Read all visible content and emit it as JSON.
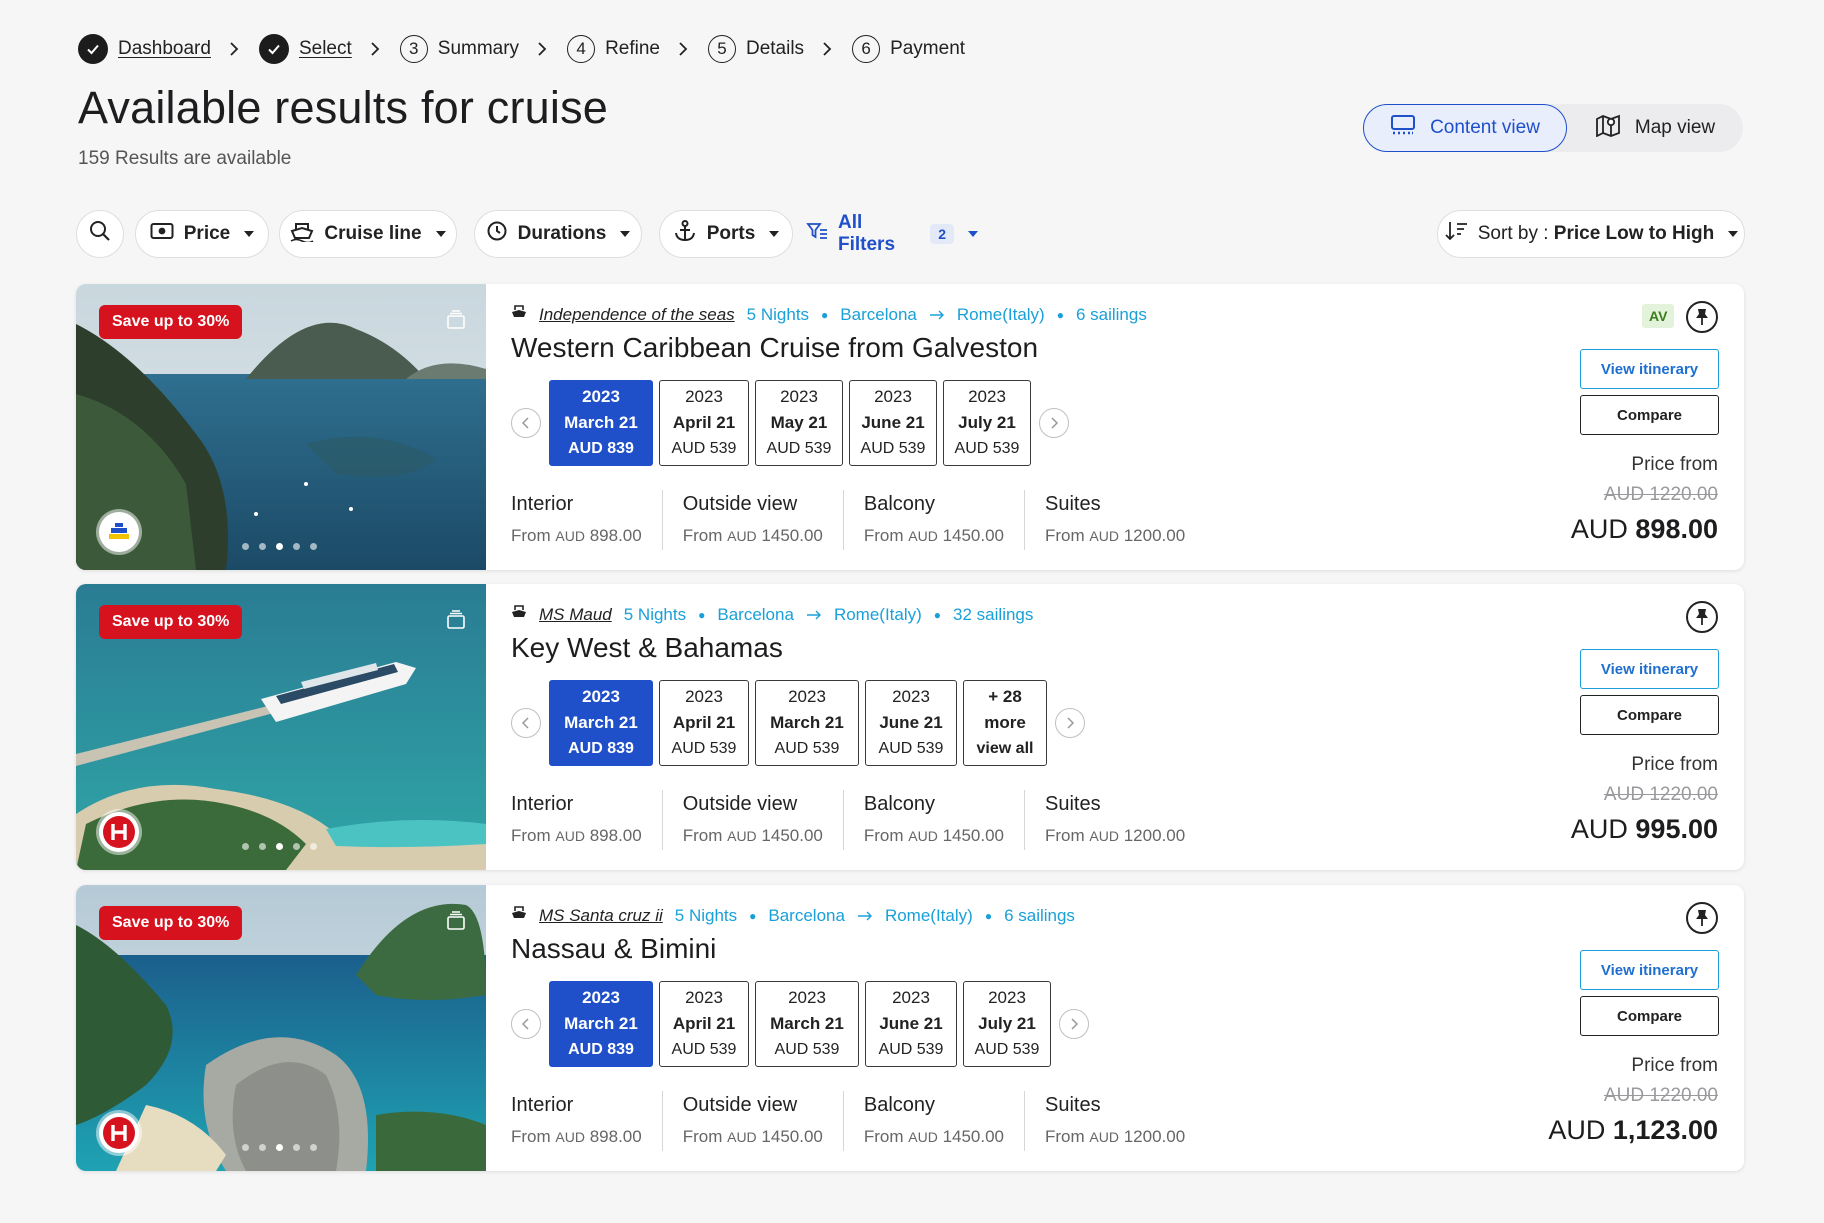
{
  "breadcrumb": [
    {
      "label": "Dashboard",
      "done": true
    },
    {
      "label": "Select",
      "done": true
    },
    {
      "num": "3",
      "label": "Summary"
    },
    {
      "num": "4",
      "label": "Refine"
    },
    {
      "num": "5",
      "label": "Details"
    },
    {
      "num": "6",
      "label": "Payment"
    }
  ],
  "page": {
    "title": "Available results for cruise",
    "count": "159 Results are available"
  },
  "views": {
    "content": "Content view",
    "map": "Map view"
  },
  "filters": {
    "price": "Price",
    "cruise_line": "Cruise line",
    "durations": "Durations",
    "ports": "Ports",
    "all": "All Filters",
    "all_count": "2",
    "sort_label": "Sort by : ",
    "sort_value": "Price Low to High"
  },
  "cards": [
    {
      "save": "Save up to 30%",
      "ship": "Independence of the seas",
      "nights": "5 Nights",
      "from": "Barcelona",
      "to": "Rome(Italy)",
      "sailings": "6 sailings",
      "title": "Western Caribbean Cruise from Galveston",
      "av": "AV",
      "dates": [
        {
          "y": "2023",
          "md": "March 21",
          "p": "AUD 839"
        },
        {
          "y": "2023",
          "md": "April 21",
          "p": "AUD 539"
        },
        {
          "y": "2023",
          "md": "May 21",
          "p": "AUD 539"
        },
        {
          "y": "2023",
          "md": "June 21",
          "p": "AUD 539"
        },
        {
          "y": "2023",
          "md": "July 21",
          "p": "AUD 539"
        }
      ],
      "cabins": [
        {
          "t": "Interior",
          "f": "From",
          "c": "AUD",
          "v": "898.00"
        },
        {
          "t": "Outside view",
          "f": "From",
          "c": "AUD",
          "v": "1450.00"
        },
        {
          "t": "Balcony",
          "f": "From",
          "c": "AUD",
          "v": "1450.00"
        },
        {
          "t": "Suites",
          "f": "From",
          "c": "AUD",
          "v": "1200.00"
        }
      ],
      "view_itinerary": "View itinerary",
      "compare": "Compare",
      "price_from": "Price from",
      "old_price": "AUD 1220.00",
      "cur": "AUD",
      "price": "898.00"
    },
    {
      "save": "Save up to 30%",
      "ship": "MS Maud",
      "nights": "5 Nights",
      "from": "Barcelona",
      "to": "Rome(Italy)",
      "sailings": "32 sailings",
      "title": "Key West & Bahamas",
      "dates": [
        {
          "y": "2023",
          "md": "March 21",
          "p": "AUD 839"
        },
        {
          "y": "2023",
          "md": "April 21",
          "p": "AUD 539"
        },
        {
          "y": "2023",
          "md": "March 21",
          "p": "AUD 539"
        },
        {
          "y": "2023",
          "md": "June 21",
          "p": "AUD 539"
        },
        {
          "y": "+ 28",
          "md": "more",
          "p": "view all"
        }
      ],
      "cabins": [
        {
          "t": "Interior",
          "f": "From",
          "c": "AUD",
          "v": "898.00"
        },
        {
          "t": "Outside view",
          "f": "From",
          "c": "AUD",
          "v": "1450.00"
        },
        {
          "t": "Balcony",
          "f": "From",
          "c": "AUD",
          "v": "1450.00"
        },
        {
          "t": "Suites",
          "f": "From",
          "c": "AUD",
          "v": "1200.00"
        }
      ],
      "view_itinerary": "View itinerary",
      "compare": "Compare",
      "price_from": "Price from",
      "old_price": "AUD 1220.00",
      "cur": "AUD",
      "price": "995.00"
    },
    {
      "save": "Save up to 30%",
      "ship": "MS Santa cruz ii",
      "nights": "5 Nights",
      "from": "Barcelona",
      "to": "Rome(Italy)",
      "sailings": "6 sailings",
      "title": "Nassau & Bimini",
      "dates": [
        {
          "y": "2023",
          "md": "March 21",
          "p": "AUD 839"
        },
        {
          "y": "2023",
          "md": "April 21",
          "p": "AUD 539"
        },
        {
          "y": "2023",
          "md": "March 21",
          "p": "AUD 539"
        },
        {
          "y": "2023",
          "md": "June 21",
          "p": "AUD 539"
        },
        {
          "y": "2023",
          "md": "July 21",
          "p": "AUD 539"
        }
      ],
      "cabins": [
        {
          "t": "Interior",
          "f": "From",
          "c": "AUD",
          "v": "898.00"
        },
        {
          "t": "Outside view",
          "f": "From",
          "c": "AUD",
          "v": "1450.00"
        },
        {
          "t": "Balcony",
          "f": "From",
          "c": "AUD",
          "v": "1450.00"
        },
        {
          "t": "Suites",
          "f": "From",
          "c": "AUD",
          "v": "1200.00"
        }
      ],
      "view_itinerary": "View itinerary",
      "compare": "Compare",
      "price_from": "Price from",
      "old_price": "AUD 1220.00",
      "cur": "AUD",
      "price": "1,123.00"
    }
  ],
  "colors": {
    "primary": "#1f4fc9",
    "accent": "#1aa0d8",
    "sale": "#d7121f"
  },
  "icons": [
    "check-icon",
    "chevron-right-icon",
    "search-icon",
    "price-tag-icon",
    "ship-icon",
    "clock-icon",
    "anchor-icon",
    "filter-icon",
    "sort-icon",
    "monitor-icon",
    "map-icon",
    "pin-icon",
    "gallery-icon",
    "arrow-right-icon"
  ]
}
